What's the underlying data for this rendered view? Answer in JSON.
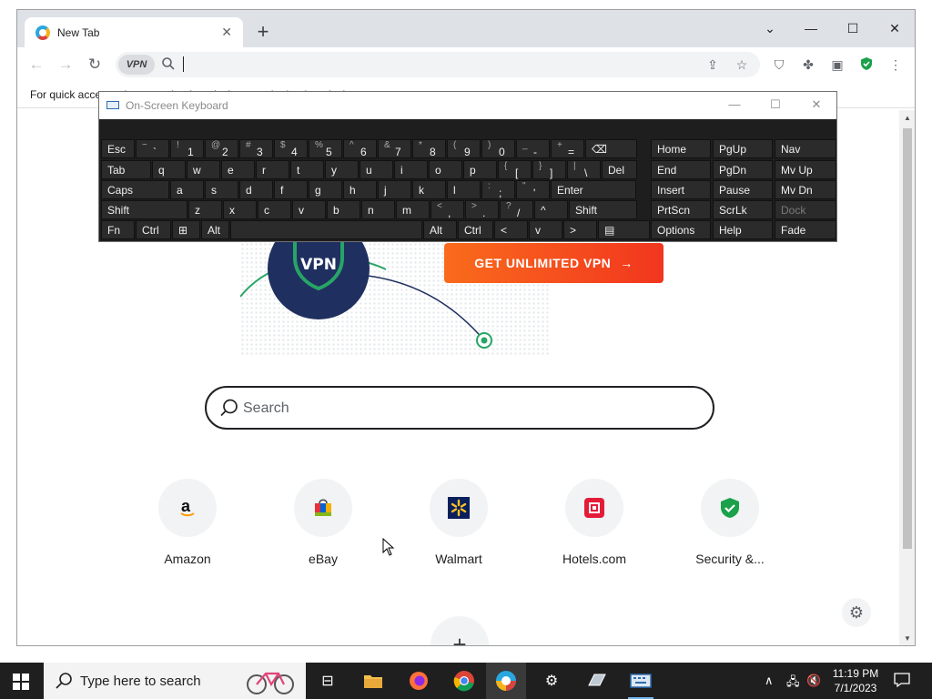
{
  "browser": {
    "tab_title": "New Tab",
    "bookmark_hint": "For quick access, place your bookmarks here on the bookmarks bar.",
    "omnibox_value": "",
    "vpn_badge": "VPN"
  },
  "hero": {
    "vpn_label": "VPN",
    "cta_label": "GET UNLIMITED VPN",
    "cta_arrow": "→"
  },
  "search": {
    "placeholder": "Search"
  },
  "shortcuts": [
    {
      "label": "Amazon",
      "icon": "amazon-icon"
    },
    {
      "label": "eBay",
      "icon": "ebay-icon"
    },
    {
      "label": "Walmart",
      "icon": "walmart-icon"
    },
    {
      "label": "Hotels.com",
      "icon": "hotels-icon"
    },
    {
      "label": "Security &...",
      "icon": "security-shield-icon"
    }
  ],
  "osk": {
    "title": "On-Screen Keyboard",
    "rows": [
      [
        {
          "l": "Esc"
        },
        {
          "l": "`",
          "s": "~"
        },
        {
          "l": "1",
          "s": "!"
        },
        {
          "l": "2",
          "s": "@"
        },
        {
          "l": "3",
          "s": "#"
        },
        {
          "l": "4",
          "s": "$"
        },
        {
          "l": "5",
          "s": "%"
        },
        {
          "l": "6",
          "s": "^"
        },
        {
          "l": "7",
          "s": "&"
        },
        {
          "l": "8",
          "s": "*"
        },
        {
          "l": "9",
          "s": "("
        },
        {
          "l": "0",
          "s": ")"
        },
        {
          "l": "-",
          "s": "_"
        },
        {
          "l": "=",
          "s": "+"
        },
        {
          "l": "⌫"
        }
      ],
      [
        {
          "l": "Tab"
        },
        {
          "l": "q"
        },
        {
          "l": "w"
        },
        {
          "l": "e"
        },
        {
          "l": "r"
        },
        {
          "l": "t"
        },
        {
          "l": "y"
        },
        {
          "l": "u"
        },
        {
          "l": "i"
        },
        {
          "l": "o"
        },
        {
          "l": "p"
        },
        {
          "l": "[",
          "s": "{"
        },
        {
          "l": "]",
          "s": "}"
        },
        {
          "l": "\\",
          "s": "|"
        },
        {
          "l": "Del"
        }
      ],
      [
        {
          "l": "Caps"
        },
        {
          "l": "a"
        },
        {
          "l": "s"
        },
        {
          "l": "d"
        },
        {
          "l": "f"
        },
        {
          "l": "g"
        },
        {
          "l": "h"
        },
        {
          "l": "j"
        },
        {
          "l": "k"
        },
        {
          "l": "l"
        },
        {
          "l": ";",
          "s": ":"
        },
        {
          "l": "'",
          "s": "\""
        },
        {
          "l": "Enter"
        }
      ],
      [
        {
          "l": "Shift"
        },
        {
          "l": "z"
        },
        {
          "l": "x"
        },
        {
          "l": "c"
        },
        {
          "l": "v"
        },
        {
          "l": "b"
        },
        {
          "l": "n"
        },
        {
          "l": "m"
        },
        {
          "l": ",",
          "s": "<"
        },
        {
          "l": ".",
          "s": ">"
        },
        {
          "l": "/",
          "s": "?"
        },
        {
          "l": "^"
        },
        {
          "l": "Shift"
        }
      ],
      [
        {
          "l": "Fn"
        },
        {
          "l": "Ctrl"
        },
        {
          "l": "⊞"
        },
        {
          "l": "Alt"
        },
        {
          "l": ""
        },
        {
          "l": "Alt"
        },
        {
          "l": "Ctrl"
        },
        {
          "l": "<"
        },
        {
          "l": "v"
        },
        {
          "l": ">"
        },
        {
          "l": "▤"
        }
      ]
    ],
    "nav_keys": [
      [
        "Home",
        "PgUp",
        "Nav"
      ],
      [
        "End",
        "PgDn",
        "Mv Up"
      ],
      [
        "Insert",
        "Pause",
        "Mv Dn"
      ],
      [
        "PrtScn",
        "ScrLk",
        "Dock"
      ],
      [
        "Options",
        "Help",
        "Fade"
      ]
    ]
  },
  "taskbar": {
    "search_placeholder": "Type here to search",
    "time": "11:19 PM",
    "date": "7/1/2023"
  }
}
